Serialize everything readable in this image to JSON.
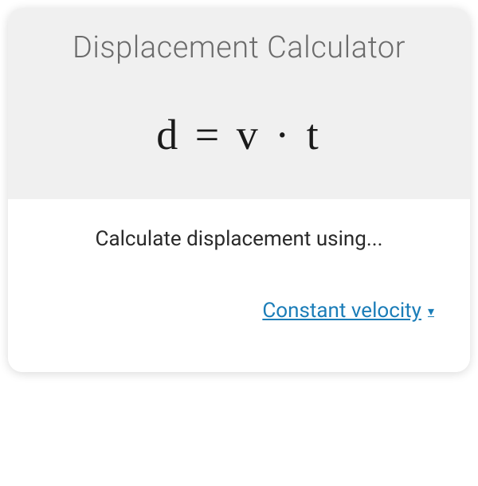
{
  "header": {
    "title": "Displacement Calculator"
  },
  "formula": {
    "expression": "d  =  v · t"
  },
  "body": {
    "prompt": "Calculate displacement using...",
    "selector_label": "Constant velocity",
    "selector_icon": "▾"
  }
}
